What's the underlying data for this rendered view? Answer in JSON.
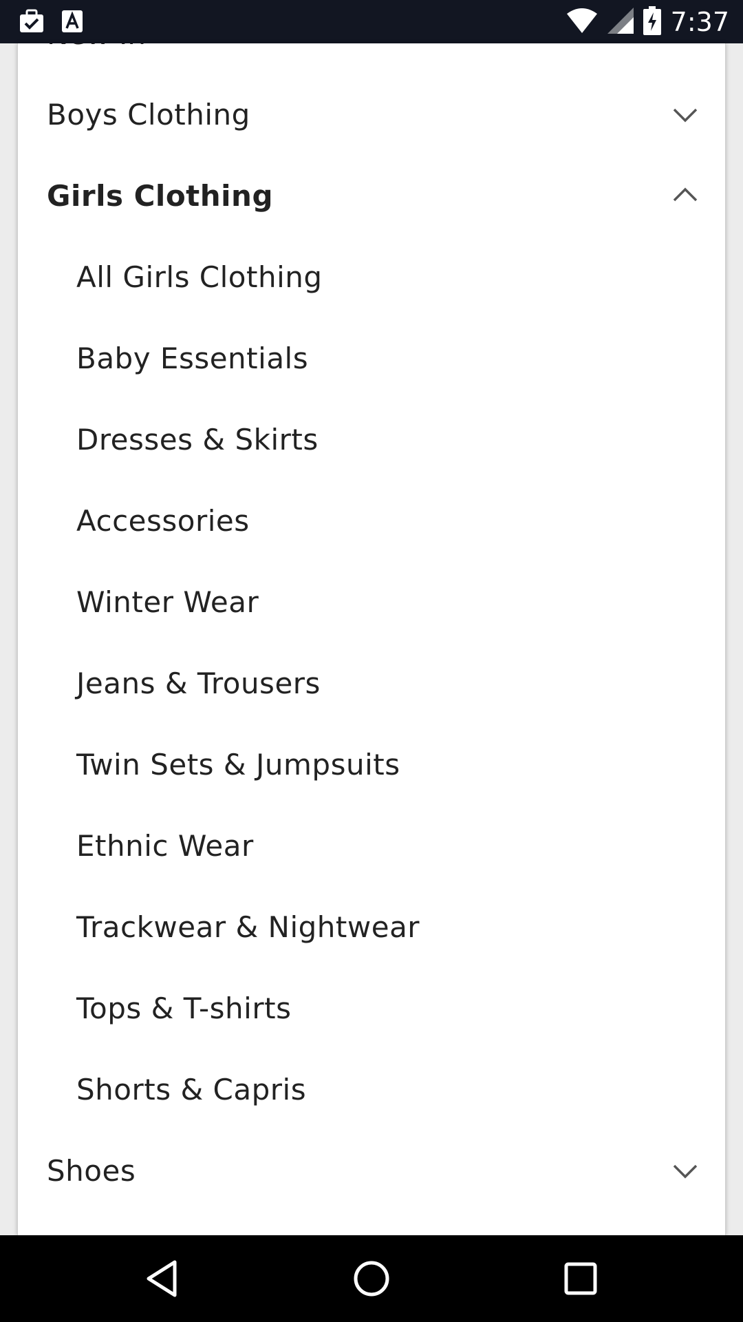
{
  "status_bar": {
    "time": "7:37",
    "icons": [
      "briefcase-check-icon",
      "text-a-icon",
      "wifi-icon",
      "signal-icon",
      "battery-charging-icon"
    ]
  },
  "menu": {
    "partial_top_item": "New In",
    "items": [
      {
        "label": "Boys Clothing",
        "state": "collapsed",
        "icon": "chevron-down-icon"
      },
      {
        "label": "Girls Clothing",
        "state": "expanded",
        "icon": "chevron-up-icon"
      },
      {
        "label": "Shoes",
        "state": "collapsed",
        "icon": "chevron-down-icon"
      }
    ],
    "girls_subitems": [
      "All Girls Clothing",
      "Baby Essentials",
      "Dresses & Skirts",
      "Accessories",
      "Winter Wear",
      "Jeans & Trousers",
      "Twin Sets & Jumpsuits",
      "Ethnic Wear",
      "Trackwear & Nightwear",
      "Tops & T-shirts",
      "Shorts & Capris"
    ]
  },
  "nav_bar": {
    "buttons": [
      "back-icon",
      "home-icon",
      "recents-icon"
    ]
  },
  "colors": {
    "status_bar": "#121622",
    "text": "#222222",
    "chevron": "#555555",
    "nav_bar": "#000000"
  }
}
